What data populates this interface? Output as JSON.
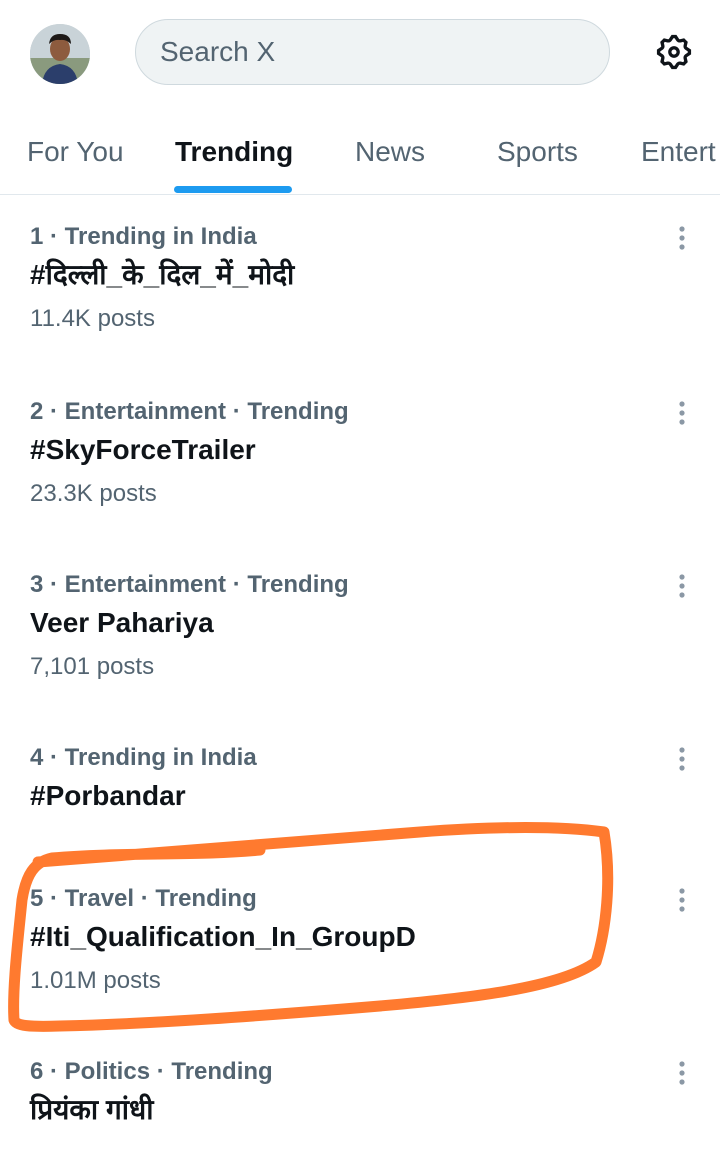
{
  "header": {
    "search_placeholder": "Search X",
    "avatar_icon": "profile-avatar",
    "settings_icon": "gear-icon"
  },
  "tabs": [
    {
      "label": "For You",
      "active": false
    },
    {
      "label": "Trending",
      "active": true
    },
    {
      "label": "News",
      "active": false
    },
    {
      "label": "Sports",
      "active": false
    },
    {
      "label": "Entert",
      "active": false
    }
  ],
  "trends": [
    {
      "meta": "1 · Trending in India",
      "topic": "#दिल्ली_के_दिल_में_मोदी",
      "count": "11.4K posts"
    },
    {
      "meta": "2 · Entertainment · Trending",
      "topic": "#SkyForceTrailer",
      "count": "23.3K posts"
    },
    {
      "meta": "3 · Entertainment · Trending",
      "topic": "Veer Pahariya",
      "count": "7,101 posts"
    },
    {
      "meta": "4 · Trending in India",
      "topic": "#Porbandar",
      "count": ""
    },
    {
      "meta": "5 · Travel · Trending",
      "topic": "#Iti_Qualification_In_GroupD",
      "count": "1.01M posts"
    },
    {
      "meta": "6 · Politics · Trending",
      "topic": "प्रियंका गांधी",
      "count": ""
    }
  ],
  "colors": {
    "accent": "#1d9bf0",
    "highlight_stroke": "#ff7a2f",
    "secondary_text": "#536471"
  }
}
